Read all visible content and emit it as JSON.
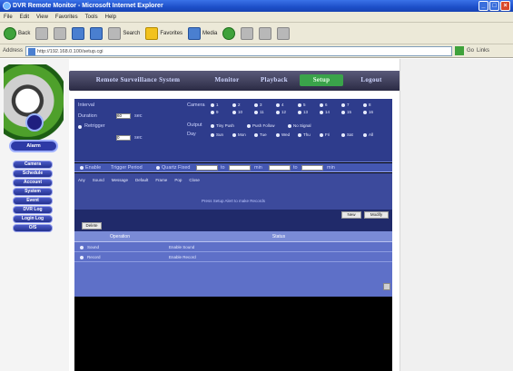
{
  "window": {
    "title": "DVR Remote Monitor - Microsoft Internet Explorer",
    "buttons": [
      "_",
      "□",
      "×"
    ]
  },
  "menu": {
    "items": [
      "File",
      "Edit",
      "View",
      "Favorites",
      "Tools",
      "Help"
    ]
  },
  "toolbar": {
    "back": "Back",
    "search": "Search",
    "favorites": "Favorites",
    "media": "Media"
  },
  "address": {
    "label": "Address",
    "value": "http://192.168.0.100/setup.cgi",
    "go": "Go",
    "links": "Links"
  },
  "app": {
    "topnav": [
      {
        "label": "Remote Surveillance System",
        "active": false
      },
      {
        "label": "Monitor",
        "active": false
      },
      {
        "label": "Playback",
        "active": false
      },
      {
        "label": "Setup",
        "active": true
      },
      {
        "label": "Logout",
        "active": false
      }
    ],
    "sidebar": {
      "active": "Alarm",
      "items": [
        "Camera",
        "Schedule",
        "Account",
        "System",
        "Event",
        "DVR Log",
        "Login Log",
        "O/S"
      ]
    },
    "form": {
      "interval_label": "Interval",
      "duration_label": "Duration",
      "duration_value": "60",
      "duration_unit": "sec",
      "retrigger_label": "Retrigger",
      "retrigger_value": "0",
      "retrigger_unit": "sec",
      "camera_label": "Camera",
      "camera_options": [
        "1",
        "2",
        "3",
        "4",
        "5",
        "6",
        "7",
        "8",
        "9",
        "10",
        "11",
        "12",
        "13",
        "14",
        "15",
        "16"
      ],
      "output_label": "Output",
      "output_options": [
        "Tiny Push",
        "Push Follow",
        "No Signal"
      ],
      "day_label": "Day",
      "day_options": [
        "Sun",
        "Mon",
        "Tue",
        "Wed",
        "Thu",
        "Fri",
        "Sat",
        "All"
      ],
      "enable_label": "Enable",
      "trigger_label": "Trigger Period",
      "schedule_label": "Quartz Fixed",
      "to_label": "to",
      "min_label": "min"
    },
    "options": [
      "Any",
      "Sound",
      "Message",
      "Default",
      "Frame",
      "Pop",
      "Close"
    ],
    "hint": "Press Setup Alert to make Records",
    "buttons": {
      "new": "New",
      "modify": "Modify",
      "delete": "Delete"
    },
    "table": {
      "columns": [
        "Operation",
        "Status"
      ],
      "rows": [
        {
          "operation": "Sound",
          "status": "Enable Sound"
        },
        {
          "operation": "Record",
          "status": "Enable Record"
        }
      ]
    }
  }
}
